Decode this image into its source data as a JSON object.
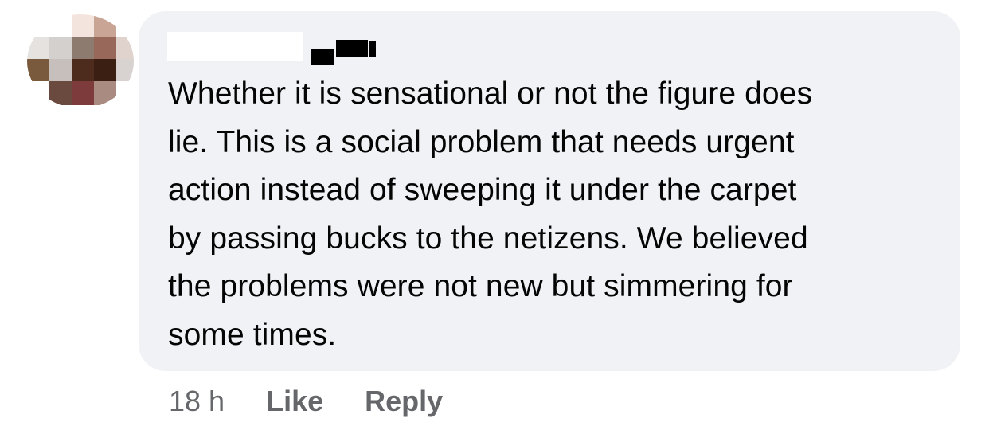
{
  "comment": {
    "body": "Whether it is sensational or not the figure does\nlie. This is a social problem that needs urgent\naction instead of sweeping it under the carpet\nby passing bucks to the netizens. We believed\nthe problems were not new but simmering for\nsome times."
  },
  "actions": {
    "timestamp": "18 h",
    "like_label": "Like",
    "reply_label": "Reply"
  },
  "colors": {
    "bubble_background": "#f0f2f5",
    "text": "#050505",
    "secondary_text": "#65676b"
  },
  "icons": {
    "avatar": "censored-profile-picture"
  }
}
